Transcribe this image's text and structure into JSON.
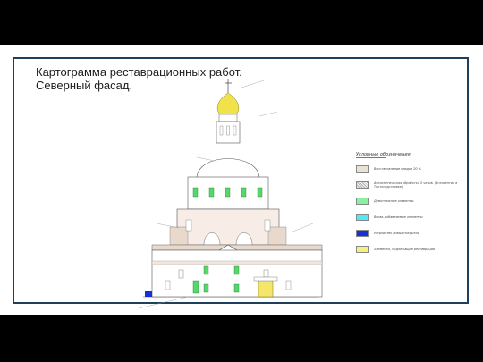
{
  "slide": {
    "title_line1": "Картограмма реставрационных работ.",
    "title_line2": "Северный фасад."
  },
  "legend": {
    "title": "Условные обозначения",
    "items": [
      {
        "color": "#e9e3d4",
        "pattern": "solid",
        "label": "Восстановление кладки 20 %"
      },
      {
        "color": "#eeeeee",
        "pattern": "hatch",
        "label": "Антисептическая обработка 5 челов. (Антисептик в Тектоподготовке)"
      },
      {
        "color": "#8cf0a0",
        "pattern": "solid",
        "label": "Демонтажные элементы"
      },
      {
        "color": "#52e8f4",
        "pattern": "solid",
        "label": "Вновь добавляемые элементы"
      },
      {
        "color": "#1a2fd6",
        "pattern": "solid",
        "label": "Устройство новых покрытий"
      },
      {
        "color": "#f6f080",
        "pattern": "solid",
        "label": "Элементы, подлежащие реставрации"
      }
    ]
  },
  "colors": {
    "frame": "#1f3f5e",
    "dome": "#f2e24a",
    "window_green": "#55d86a",
    "door_yellow": "#f4e66a",
    "blue_mark": "#1a2fd6",
    "brick": "#e9d9cd"
  }
}
